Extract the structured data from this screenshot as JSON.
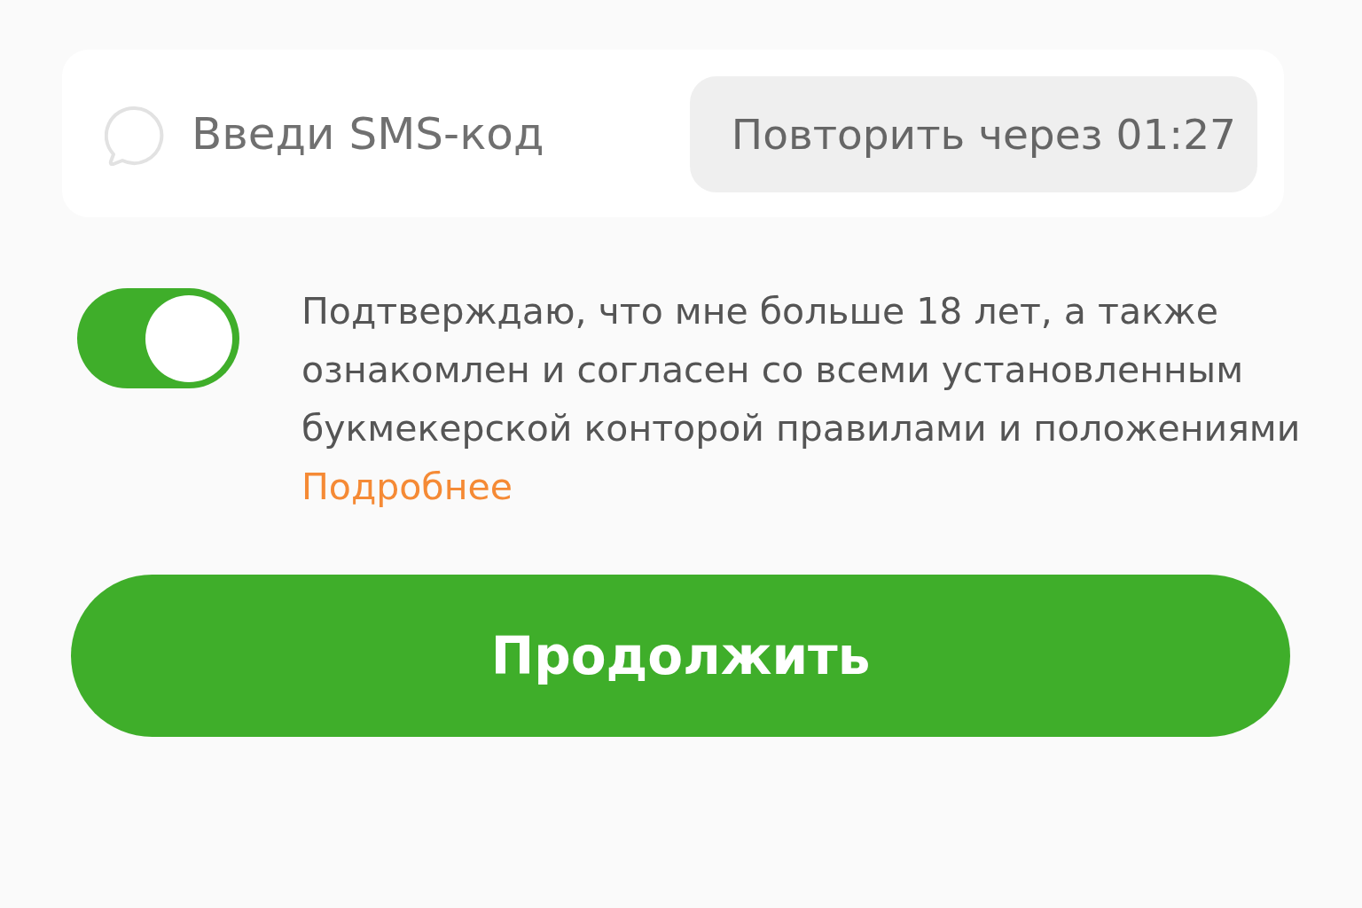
{
  "sms_panel": {
    "input": {
      "placeholder": "Введи SMS-код"
    },
    "resend_button": {
      "label": "Повторить через 01:27",
      "disabled": true
    }
  },
  "consent": {
    "on": true,
    "text": "Подтверждаю, что мне больше 18 лет, а также ознакомлен и согласен со всеми установленным букмекерской конторой правилами и положениями",
    "link": "Подробнее"
  },
  "continue_button": {
    "label": "Продолжить"
  }
}
